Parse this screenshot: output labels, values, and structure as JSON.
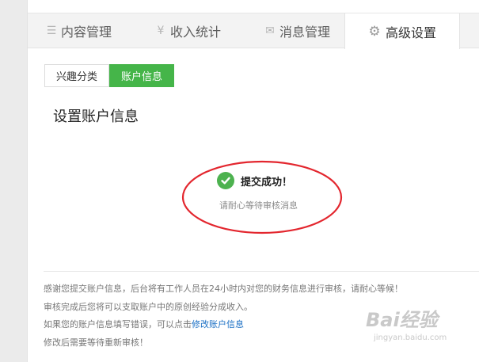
{
  "tabs": [
    {
      "label": "内容管理",
      "icon": "list-icon",
      "glyph": "☰"
    },
    {
      "label": "收入统计",
      "icon": "yen-icon",
      "glyph": "¥"
    },
    {
      "label": "消息管理",
      "icon": "envelope-icon",
      "glyph": "✉"
    },
    {
      "label": "高级设置",
      "icon": "gear-icon",
      "glyph": "⚙",
      "active": true
    }
  ],
  "subtabs": [
    {
      "label": "兴趣分类"
    },
    {
      "label": "账户信息",
      "active": true
    }
  ],
  "section_title": "设置账户信息",
  "success": {
    "title": "提交成功！",
    "subtitle": "请耐心等待审核消息"
  },
  "notes": {
    "line1": "感谢您提交账户信息，后台将有工作人员在24小时内对您的财务信息进行审核，请耐心等候！",
    "line2": "审核完成后您将可以支取账户中的原创经验分成收入。",
    "line3_prefix": "如果您的账户信息填写错误，可以点击",
    "line3_link": "修改账户信息",
    "line4": "修改后需要等待重新审核！"
  },
  "watermark": {
    "brand": "Bai经验",
    "url": "jingyan.baidu.com"
  },
  "colors": {
    "accent_green": "#45b549",
    "success_green": "#4db24f",
    "annotation_red": "#e3262e",
    "link_blue": "#1a6fc4"
  }
}
